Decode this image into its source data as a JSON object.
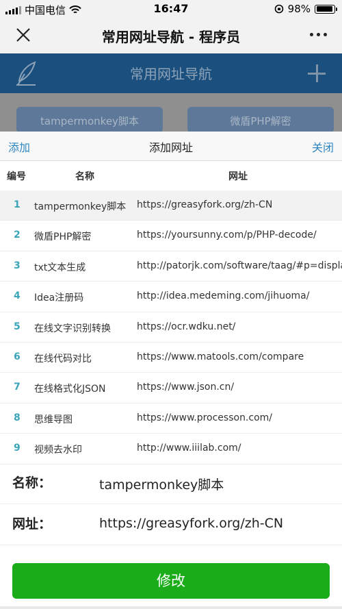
{
  "status_bar": {
    "carrier": "中国电信",
    "time": "16:47",
    "battery": "98%",
    "battery_level": 0.98
  },
  "nav": {
    "title": "常用网址导航 - 程序员"
  },
  "background_page": {
    "title": "常用网址导航",
    "cards": [
      "tampermonkey脚本",
      "微盾PHP解密"
    ]
  },
  "sheet": {
    "add_label": "添加",
    "title": "添加网址",
    "close_label": "关闭",
    "columns": [
      "编号",
      "名称",
      "网址"
    ],
    "rows": [
      {
        "num": "1",
        "name": "tampermonkey脚本",
        "url": "https://greasyfork.org/zh-CN"
      },
      {
        "num": "2",
        "name": "微盾PHP解密",
        "url": "https://yoursunny.com/p/PHP-decode/"
      },
      {
        "num": "3",
        "name": "txt文本生成",
        "url": "http://patorjk.com/software/taag/#p=display"
      },
      {
        "num": "4",
        "name": "Idea注册码",
        "url": "http://idea.medeming.com/jihuoma/"
      },
      {
        "num": "5",
        "name": "在线文字识别转换",
        "url": "https://ocr.wdku.net/"
      },
      {
        "num": "6",
        "name": "在线代码对比",
        "url": "https://www.matools.com/compare"
      },
      {
        "num": "7",
        "name": "在线格式化JSON",
        "url": "https://www.json.cn/"
      },
      {
        "num": "8",
        "name": "思维导图",
        "url": "https://www.processon.com/"
      },
      {
        "num": "9",
        "name": "视频去水印",
        "url": "http://www.iiilab.com/"
      }
    ],
    "form": {
      "name_label": "名称：",
      "name_value": "tampermonkey脚本",
      "url_label": "网址：",
      "url_value": "https://greasyfork.org/zh-CN"
    },
    "submit_label": "修改"
  },
  "colors": {
    "accent_blue": "#2e86c1",
    "submit_green": "#1aad19",
    "number_teal": "#3ba6b9",
    "header_navy": "#1a4f7e"
  }
}
